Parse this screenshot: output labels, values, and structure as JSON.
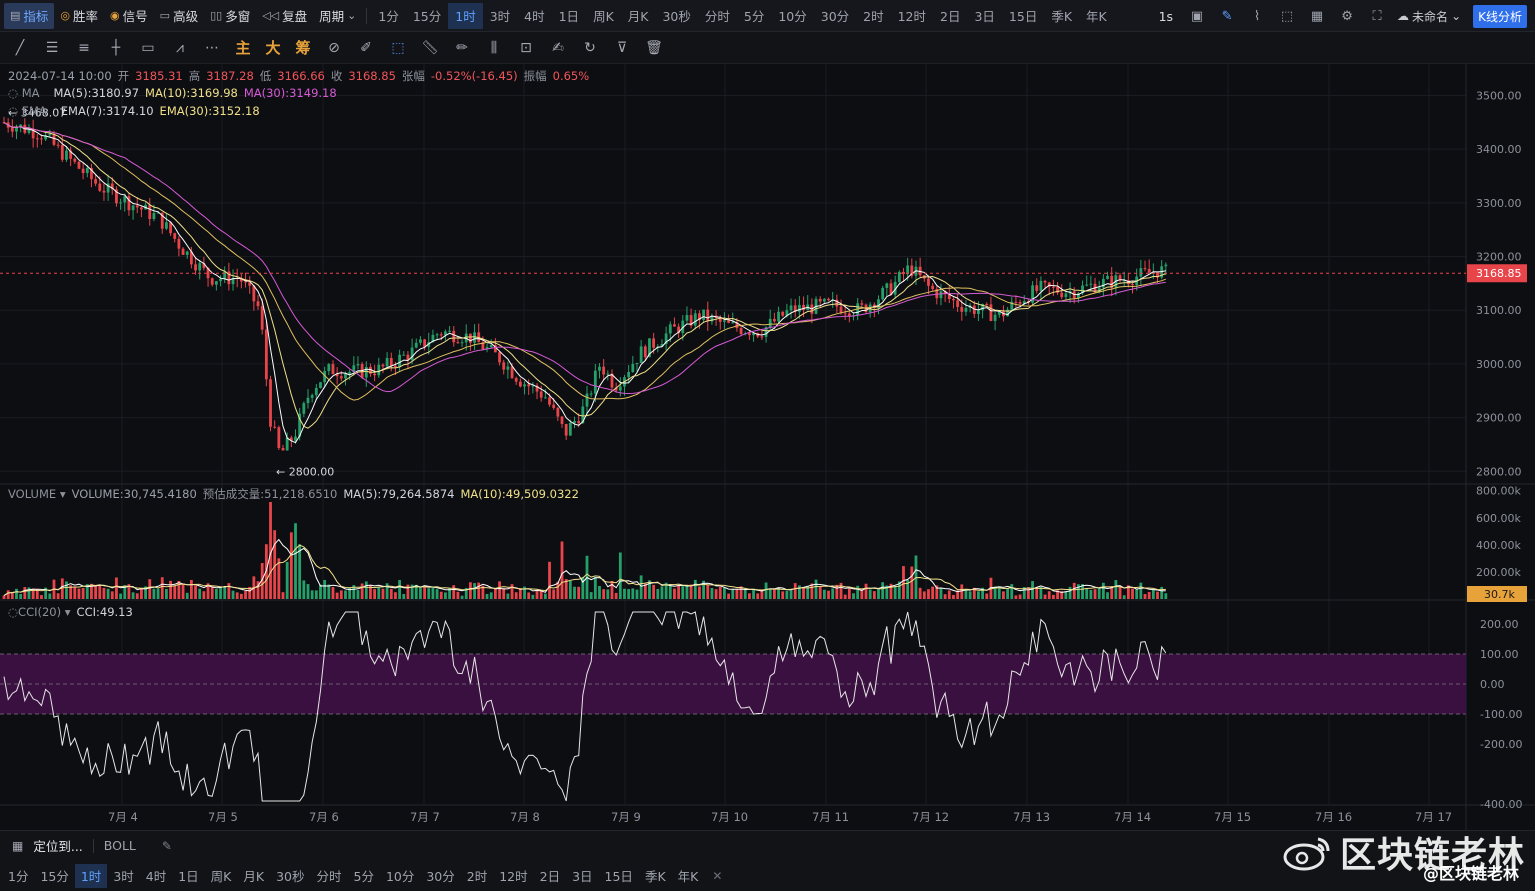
{
  "toolbar": {
    "indicator": "指标",
    "winrate": "胜率",
    "signal": "信号",
    "advanced": "高级",
    "multiwindow": "多窗",
    "replay": "复盘",
    "period": "周期",
    "periods": [
      "1分",
      "15分",
      "1时",
      "3时",
      "4时",
      "1日",
      "周K",
      "月K",
      "30秒",
      "分时",
      "5分",
      "10分",
      "30分",
      "2时",
      "12时",
      "2日",
      "3日",
      "15日",
      "季K",
      "年K"
    ],
    "active_period": "1时",
    "speed": "1s",
    "layout_name": "未命名",
    "kline_analysis": "K线分析"
  },
  "drawtools": {
    "main": "主",
    "big": "大",
    "chip": "筹"
  },
  "legend": {
    "date": "2024-07-14 10:00",
    "open_label": "开",
    "open": "3185.31",
    "high_label": "高",
    "high": "3187.28",
    "low_label": "低",
    "low": "3166.66",
    "close_label": "收",
    "close": "3168.85",
    "change_label": "张幅",
    "change": "-0.52%(-16.45)",
    "amp_label": "振幅",
    "amp": "0.65%",
    "ma_label": "MA",
    "ma5": "MA(5):3180.97",
    "ma10": "MA(10):3169.98",
    "ma30": "MA(30):3149.18",
    "ema_label": "EMA",
    "ema7": "EMA(7):3174.10",
    "ema30": "EMA(30):3152.18"
  },
  "volume_legend": {
    "label": "VOLUME",
    "volume": "VOLUME:30,745.4180",
    "estimate": "预估成交量:51,218.6510",
    "ma5": "MA(5):79,264.5874",
    "ma10": "MA(10):49,509.0322"
  },
  "cci_legend": {
    "label": "CCI(20)",
    "value": "CCI:49.13"
  },
  "price_axis": [
    "3500.00",
    "3400.00",
    "3300.00",
    "3200.00",
    "3100.00",
    "3000.00",
    "2900.00",
    "2800.00"
  ],
  "volume_axis": [
    "800.00k",
    "600.00k",
    "400.00k",
    "200.00k"
  ],
  "cci_axis": [
    "200.00",
    "100.00",
    "0.00",
    "-100.00",
    "-200.00",
    "-400.00"
  ],
  "current_price_tag": "3168.85",
  "current_volume_tag": "30.7k",
  "max_price_tag": "3468.07",
  "min_price_tag": "2800.00",
  "date_axis": [
    "7月 4",
    "7月 5",
    "7月 6",
    "7月 7",
    "7月 8",
    "7月 9",
    "7月 10",
    "7月 11",
    "7月 12",
    "7月 13",
    "7月 14",
    "7月 15",
    "7月 16",
    "7月 17"
  ],
  "bottom": {
    "locate": "定位到...",
    "boll": "BOLL",
    "periods": [
      "1分",
      "15分",
      "1时",
      "3时",
      "4时",
      "1日",
      "周K",
      "月K",
      "30秒",
      "分时",
      "5分",
      "10分",
      "30分",
      "2时",
      "12时",
      "2日",
      "3日",
      "15日",
      "季K",
      "年K"
    ],
    "active_period": "1时"
  },
  "watermark": {
    "big": "区块链老林",
    "small": "@区块链老林"
  },
  "colors": {
    "up": "#26a06b",
    "down": "#e8454b",
    "ma5": "#ffffff",
    "ma10": "#f0e08a",
    "ma30": "#d65ad6",
    "accent": "#2f6fea",
    "cci_band": "#3a1040"
  },
  "chart_data": {
    "type": "candlestick",
    "symbol_interval": "1时",
    "price_range": [
      2780,
      3540
    ],
    "key_prices": [
      {
        "label": "7月 4",
        "price": 3430
      },
      {
        "label": "7月 5",
        "price": 3190
      },
      {
        "label": "7月 6",
        "price": 2880
      },
      {
        "label": "7月 7",
        "price": 3060
      },
      {
        "label": "7月 8",
        "price": 2900
      },
      {
        "label": "7月 9",
        "price": 3050
      },
      {
        "label": "7月 10",
        "price": 3080
      },
      {
        "label": "7月 11",
        "price": 3120
      },
      {
        "label": "7月 12",
        "price": 3140
      },
      {
        "label": "7月 13",
        "price": 3110
      },
      {
        "label": "7月 14",
        "price": 3170
      }
    ],
    "last_close": 3168.85,
    "cci_range": [
      -400,
      250
    ]
  }
}
